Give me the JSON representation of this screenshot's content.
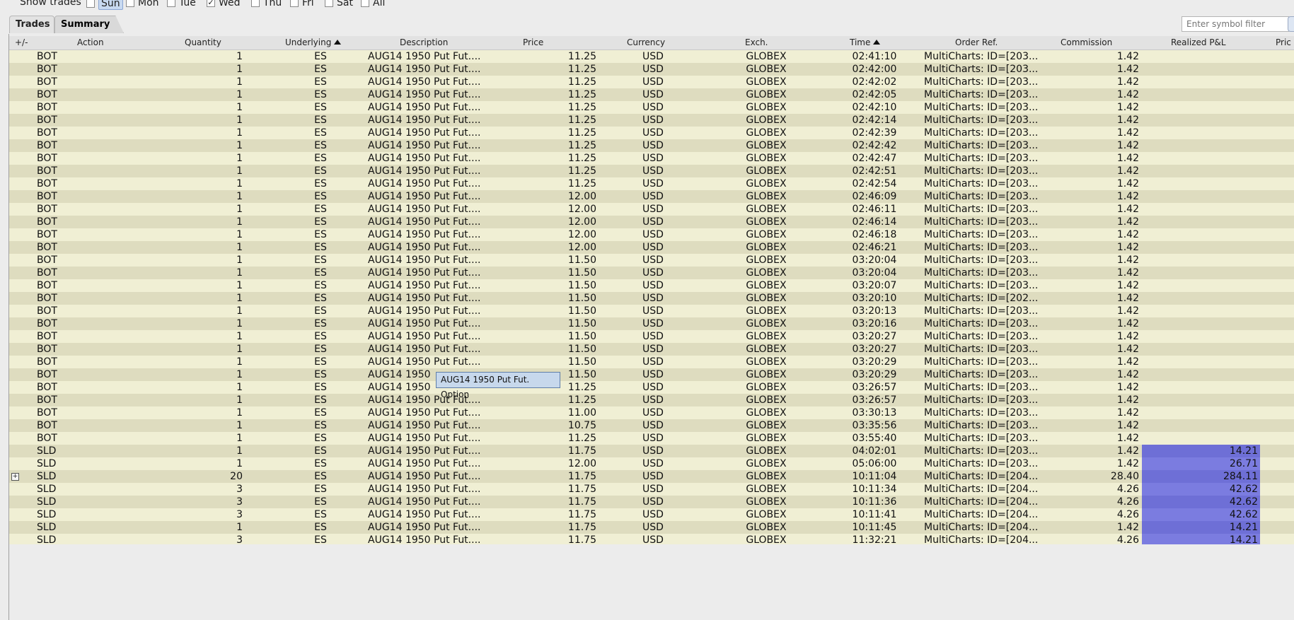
{
  "toolbar": {
    "show_trades_label": "Show trades",
    "days": [
      {
        "label": "Sun",
        "checked": false,
        "selected": true
      },
      {
        "label": "Mon",
        "checked": false,
        "selected": false
      },
      {
        "label": "Tue",
        "checked": false,
        "selected": false
      },
      {
        "label": "Wed",
        "checked": true,
        "selected": false
      },
      {
        "label": "Thu",
        "checked": false,
        "selected": false
      },
      {
        "label": "Fri",
        "checked": false,
        "selected": false
      },
      {
        "label": "Sat",
        "checked": false,
        "selected": false
      },
      {
        "label": "All",
        "checked": false,
        "selected": false
      }
    ],
    "filter_placeholder": "Enter symbol filter"
  },
  "tabs": [
    "Trades",
    "Summary"
  ],
  "columns": [
    "+/-",
    "Action",
    "Quantity",
    "Underlying",
    "Description",
    "Price",
    "Currency",
    "Exch.",
    "Time",
    "Order Ref.",
    "Commission",
    "Realized P&L",
    "Pric"
  ],
  "rows": [
    {
      "action": "BOT",
      "qty": "1",
      "und": "ES",
      "desc": "AUG14 1950 Put Fut....",
      "price": "11.25",
      "cur": "USD",
      "exch": "GLOBEX",
      "time": "02:41:10",
      "ref": "MultiCharts: ID=[203...",
      "comm": "1.42",
      "pnl": ""
    },
    {
      "action": "BOT",
      "qty": "1",
      "und": "ES",
      "desc": "AUG14 1950 Put Fut....",
      "price": "11.25",
      "cur": "USD",
      "exch": "GLOBEX",
      "time": "02:42:00",
      "ref": "MultiCharts: ID=[203...",
      "comm": "1.42",
      "pnl": ""
    },
    {
      "action": "BOT",
      "qty": "1",
      "und": "ES",
      "desc": "AUG14 1950 Put Fut....",
      "price": "11.25",
      "cur": "USD",
      "exch": "GLOBEX",
      "time": "02:42:02",
      "ref": "MultiCharts: ID=[203...",
      "comm": "1.42",
      "pnl": ""
    },
    {
      "action": "BOT",
      "qty": "1",
      "und": "ES",
      "desc": "AUG14 1950 Put Fut....",
      "price": "11.25",
      "cur": "USD",
      "exch": "GLOBEX",
      "time": "02:42:05",
      "ref": "MultiCharts: ID=[203...",
      "comm": "1.42",
      "pnl": ""
    },
    {
      "action": "BOT",
      "qty": "1",
      "und": "ES",
      "desc": "AUG14 1950 Put Fut....",
      "price": "11.25",
      "cur": "USD",
      "exch": "GLOBEX",
      "time": "02:42:10",
      "ref": "MultiCharts: ID=[203...",
      "comm": "1.42",
      "pnl": ""
    },
    {
      "action": "BOT",
      "qty": "1",
      "und": "ES",
      "desc": "AUG14 1950 Put Fut....",
      "price": "11.25",
      "cur": "USD",
      "exch": "GLOBEX",
      "time": "02:42:14",
      "ref": "MultiCharts: ID=[203...",
      "comm": "1.42",
      "pnl": ""
    },
    {
      "action": "BOT",
      "qty": "1",
      "und": "ES",
      "desc": "AUG14 1950 Put Fut....",
      "price": "11.25",
      "cur": "USD",
      "exch": "GLOBEX",
      "time": "02:42:39",
      "ref": "MultiCharts: ID=[203...",
      "comm": "1.42",
      "pnl": ""
    },
    {
      "action": "BOT",
      "qty": "1",
      "und": "ES",
      "desc": "AUG14 1950 Put Fut....",
      "price": "11.25",
      "cur": "USD",
      "exch": "GLOBEX",
      "time": "02:42:42",
      "ref": "MultiCharts: ID=[203...",
      "comm": "1.42",
      "pnl": ""
    },
    {
      "action": "BOT",
      "qty": "1",
      "und": "ES",
      "desc": "AUG14 1950 Put Fut....",
      "price": "11.25",
      "cur": "USD",
      "exch": "GLOBEX",
      "time": "02:42:47",
      "ref": "MultiCharts: ID=[203...",
      "comm": "1.42",
      "pnl": ""
    },
    {
      "action": "BOT",
      "qty": "1",
      "und": "ES",
      "desc": "AUG14 1950 Put Fut....",
      "price": "11.25",
      "cur": "USD",
      "exch": "GLOBEX",
      "time": "02:42:51",
      "ref": "MultiCharts: ID=[203...",
      "comm": "1.42",
      "pnl": ""
    },
    {
      "action": "BOT",
      "qty": "1",
      "und": "ES",
      "desc": "AUG14 1950 Put Fut....",
      "price": "11.25",
      "cur": "USD",
      "exch": "GLOBEX",
      "time": "02:42:54",
      "ref": "MultiCharts: ID=[203...",
      "comm": "1.42",
      "pnl": ""
    },
    {
      "action": "BOT",
      "qty": "1",
      "und": "ES",
      "desc": "AUG14 1950 Put Fut....",
      "price": "12.00",
      "cur": "USD",
      "exch": "GLOBEX",
      "time": "02:46:09",
      "ref": "MultiCharts: ID=[203...",
      "comm": "1.42",
      "pnl": ""
    },
    {
      "action": "BOT",
      "qty": "1",
      "und": "ES",
      "desc": "AUG14 1950 Put Fut....",
      "price": "12.00",
      "cur": "USD",
      "exch": "GLOBEX",
      "time": "02:46:11",
      "ref": "MultiCharts: ID=[203...",
      "comm": "1.42",
      "pnl": ""
    },
    {
      "action": "BOT",
      "qty": "1",
      "und": "ES",
      "desc": "AUG14 1950 Put Fut....",
      "price": "12.00",
      "cur": "USD",
      "exch": "GLOBEX",
      "time": "02:46:14",
      "ref": "MultiCharts: ID=[203...",
      "comm": "1.42",
      "pnl": ""
    },
    {
      "action": "BOT",
      "qty": "1",
      "und": "ES",
      "desc": "AUG14 1950 Put Fut....",
      "price": "12.00",
      "cur": "USD",
      "exch": "GLOBEX",
      "time": "02:46:18",
      "ref": "MultiCharts: ID=[203...",
      "comm": "1.42",
      "pnl": ""
    },
    {
      "action": "BOT",
      "qty": "1",
      "und": "ES",
      "desc": "AUG14 1950 Put Fut....",
      "price": "12.00",
      "cur": "USD",
      "exch": "GLOBEX",
      "time": "02:46:21",
      "ref": "MultiCharts: ID=[203...",
      "comm": "1.42",
      "pnl": ""
    },
    {
      "action": "BOT",
      "qty": "1",
      "und": "ES",
      "desc": "AUG14 1950 Put Fut....",
      "price": "11.50",
      "cur": "USD",
      "exch": "GLOBEX",
      "time": "03:20:04",
      "ref": "MultiCharts: ID=[203...",
      "comm": "1.42",
      "pnl": ""
    },
    {
      "action": "BOT",
      "qty": "1",
      "und": "ES",
      "desc": "AUG14 1950 Put Fut....",
      "price": "11.50",
      "cur": "USD",
      "exch": "GLOBEX",
      "time": "03:20:04",
      "ref": "MultiCharts: ID=[203...",
      "comm": "1.42",
      "pnl": ""
    },
    {
      "action": "BOT",
      "qty": "1",
      "und": "ES",
      "desc": "AUG14 1950 Put Fut....",
      "price": "11.50",
      "cur": "USD",
      "exch": "GLOBEX",
      "time": "03:20:07",
      "ref": "MultiCharts: ID=[203...",
      "comm": "1.42",
      "pnl": ""
    },
    {
      "action": "BOT",
      "qty": "1",
      "und": "ES",
      "desc": "AUG14 1950 Put Fut....",
      "price": "11.50",
      "cur": "USD",
      "exch": "GLOBEX",
      "time": "03:20:10",
      "ref": "MultiCharts: ID=[202...",
      "comm": "1.42",
      "pnl": ""
    },
    {
      "action": "BOT",
      "qty": "1",
      "und": "ES",
      "desc": "AUG14 1950 Put Fut....",
      "price": "11.50",
      "cur": "USD",
      "exch": "GLOBEX",
      "time": "03:20:13",
      "ref": "MultiCharts: ID=[203...",
      "comm": "1.42",
      "pnl": ""
    },
    {
      "action": "BOT",
      "qty": "1",
      "und": "ES",
      "desc": "AUG14 1950 Put Fut....",
      "price": "11.50",
      "cur": "USD",
      "exch": "GLOBEX",
      "time": "03:20:16",
      "ref": "MultiCharts: ID=[203...",
      "comm": "1.42",
      "pnl": ""
    },
    {
      "action": "BOT",
      "qty": "1",
      "und": "ES",
      "desc": "AUG14 1950 Put Fut....",
      "price": "11.50",
      "cur": "USD",
      "exch": "GLOBEX",
      "time": "03:20:27",
      "ref": "MultiCharts: ID=[203...",
      "comm": "1.42",
      "pnl": ""
    },
    {
      "action": "BOT",
      "qty": "1",
      "und": "ES",
      "desc": "AUG14 1950 Put Fut....",
      "price": "11.50",
      "cur": "USD",
      "exch": "GLOBEX",
      "time": "03:20:27",
      "ref": "MultiCharts: ID=[203...",
      "comm": "1.42",
      "pnl": ""
    },
    {
      "action": "BOT",
      "qty": "1",
      "und": "ES",
      "desc": "AUG14 1950 Put Fut....",
      "price": "11.50",
      "cur": "USD",
      "exch": "GLOBEX",
      "time": "03:20:29",
      "ref": "MultiCharts: ID=[203...",
      "comm": "1.42",
      "pnl": ""
    },
    {
      "action": "BOT",
      "qty": "1",
      "und": "ES",
      "desc": "AUG14 1950",
      "price": "11.50",
      "cur": "USD",
      "exch": "GLOBEX",
      "time": "03:20:29",
      "ref": "MultiCharts: ID=[203...",
      "comm": "1.42",
      "pnl": ""
    },
    {
      "action": "BOT",
      "qty": "1",
      "und": "ES",
      "desc": "AUG14 1950",
      "price": "11.25",
      "cur": "USD",
      "exch": "GLOBEX",
      "time": "03:26:57",
      "ref": "MultiCharts: ID=[203...",
      "comm": "1.42",
      "pnl": ""
    },
    {
      "action": "BOT",
      "qty": "1",
      "und": "ES",
      "desc": "AUG14 1950 Put Fut....",
      "price": "11.25",
      "cur": "USD",
      "exch": "GLOBEX",
      "time": "03:26:57",
      "ref": "MultiCharts: ID=[203...",
      "comm": "1.42",
      "pnl": ""
    },
    {
      "action": "BOT",
      "qty": "1",
      "und": "ES",
      "desc": "AUG14 1950 Put Fut....",
      "price": "11.00",
      "cur": "USD",
      "exch": "GLOBEX",
      "time": "03:30:13",
      "ref": "MultiCharts: ID=[203...",
      "comm": "1.42",
      "pnl": ""
    },
    {
      "action": "BOT",
      "qty": "1",
      "und": "ES",
      "desc": "AUG14 1950 Put Fut....",
      "price": "10.75",
      "cur": "USD",
      "exch": "GLOBEX",
      "time": "03:35:56",
      "ref": "MultiCharts: ID=[203...",
      "comm": "1.42",
      "pnl": ""
    },
    {
      "action": "BOT",
      "qty": "1",
      "und": "ES",
      "desc": "AUG14 1950 Put Fut....",
      "price": "11.25",
      "cur": "USD",
      "exch": "GLOBEX",
      "time": "03:55:40",
      "ref": "MultiCharts: ID=[203...",
      "comm": "1.42",
      "pnl": ""
    },
    {
      "action": "SLD",
      "qty": "1",
      "und": "ES",
      "desc": "AUG14 1950 Put Fut....",
      "price": "11.75",
      "cur": "USD",
      "exch": "GLOBEX",
      "time": "04:02:01",
      "ref": "MultiCharts: ID=[203...",
      "comm": "1.42",
      "pnl": "14.21"
    },
    {
      "action": "SLD",
      "qty": "1",
      "und": "ES",
      "desc": "AUG14 1950 Put Fut....",
      "price": "12.00",
      "cur": "USD",
      "exch": "GLOBEX",
      "time": "05:06:00",
      "ref": "MultiCharts: ID=[203...",
      "comm": "1.42",
      "pnl": "26.71"
    },
    {
      "action": "SLD",
      "qty": "20",
      "und": "ES",
      "desc": "AUG14 1950 Put Fut....",
      "price": "11.75",
      "cur": "USD",
      "exch": "GLOBEX",
      "time": "10:11:04",
      "ref": "MultiCharts: ID=[204...",
      "comm": "28.40",
      "pnl": "284.11",
      "expand": true
    },
    {
      "action": "SLD",
      "qty": "3",
      "und": "ES",
      "desc": "AUG14 1950 Put Fut....",
      "price": "11.75",
      "cur": "USD",
      "exch": "GLOBEX",
      "time": "10:11:34",
      "ref": "MultiCharts: ID=[204...",
      "comm": "4.26",
      "pnl": "42.62"
    },
    {
      "action": "SLD",
      "qty": "3",
      "und": "ES",
      "desc": "AUG14 1950 Put Fut....",
      "price": "11.75",
      "cur": "USD",
      "exch": "GLOBEX",
      "time": "10:11:36",
      "ref": "MultiCharts: ID=[204...",
      "comm": "4.26",
      "pnl": "42.62"
    },
    {
      "action": "SLD",
      "qty": "3",
      "und": "ES",
      "desc": "AUG14 1950 Put Fut....",
      "price": "11.75",
      "cur": "USD",
      "exch": "GLOBEX",
      "time": "10:11:41",
      "ref": "MultiCharts: ID=[204...",
      "comm": "4.26",
      "pnl": "42.62"
    },
    {
      "action": "SLD",
      "qty": "1",
      "und": "ES",
      "desc": "AUG14 1950 Put Fut....",
      "price": "11.75",
      "cur": "USD",
      "exch": "GLOBEX",
      "time": "10:11:45",
      "ref": "MultiCharts: ID=[204...",
      "comm": "1.42",
      "pnl": "14.21"
    },
    {
      "action": "SLD",
      "qty": "3",
      "und": "ES",
      "desc": "AUG14 1950 Put Fut....",
      "price": "11.75",
      "cur": "USD",
      "exch": "GLOBEX",
      "time": "11:32:21",
      "ref": "MultiCharts: ID=[204...",
      "comm": "4.26",
      "pnl": "14.21"
    }
  ],
  "tooltip": "AUG14 1950 Put Fut. Option",
  "colors": {
    "row_light": "#f0efd4",
    "row_dark": "#dedcbf",
    "pnl_highlight": "#7b7ce0"
  },
  "icons": {
    "expand": "plus-box-icon",
    "sort": "sort-ascending-icon"
  }
}
